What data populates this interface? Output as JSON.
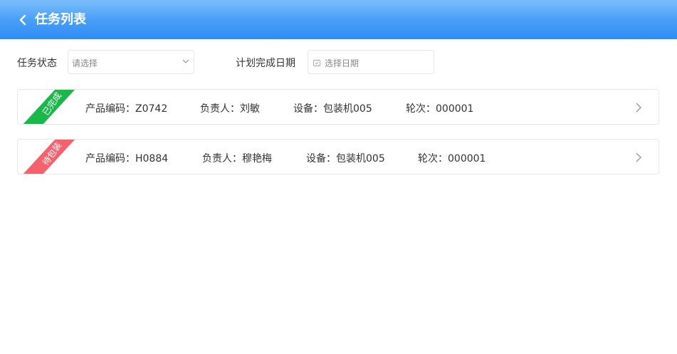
{
  "header": {
    "title": "任务列表"
  },
  "filters": {
    "status_label": "任务状态",
    "status_placeholder": "请选择",
    "date_label": "计划完成日期",
    "date_placeholder": "选择日期"
  },
  "tasks": [
    {
      "status": "已完成",
      "status_color": "#1ab84a",
      "product_code_label": "产品编码：",
      "product_code": "Z0742",
      "owner_label": "负责人：",
      "owner": "刘敏",
      "device_label": "设备：",
      "device": "包装机005",
      "round_label": "轮次：",
      "round": "000001"
    },
    {
      "status": "待包装",
      "status_color": "#f5626e",
      "product_code_label": "产品编码：",
      "product_code": "H0884",
      "owner_label": "负责人：",
      "owner": "穆艳梅",
      "device_label": "设备：",
      "device": "包装机005",
      "round_label": "轮次：",
      "round": "000001"
    }
  ]
}
